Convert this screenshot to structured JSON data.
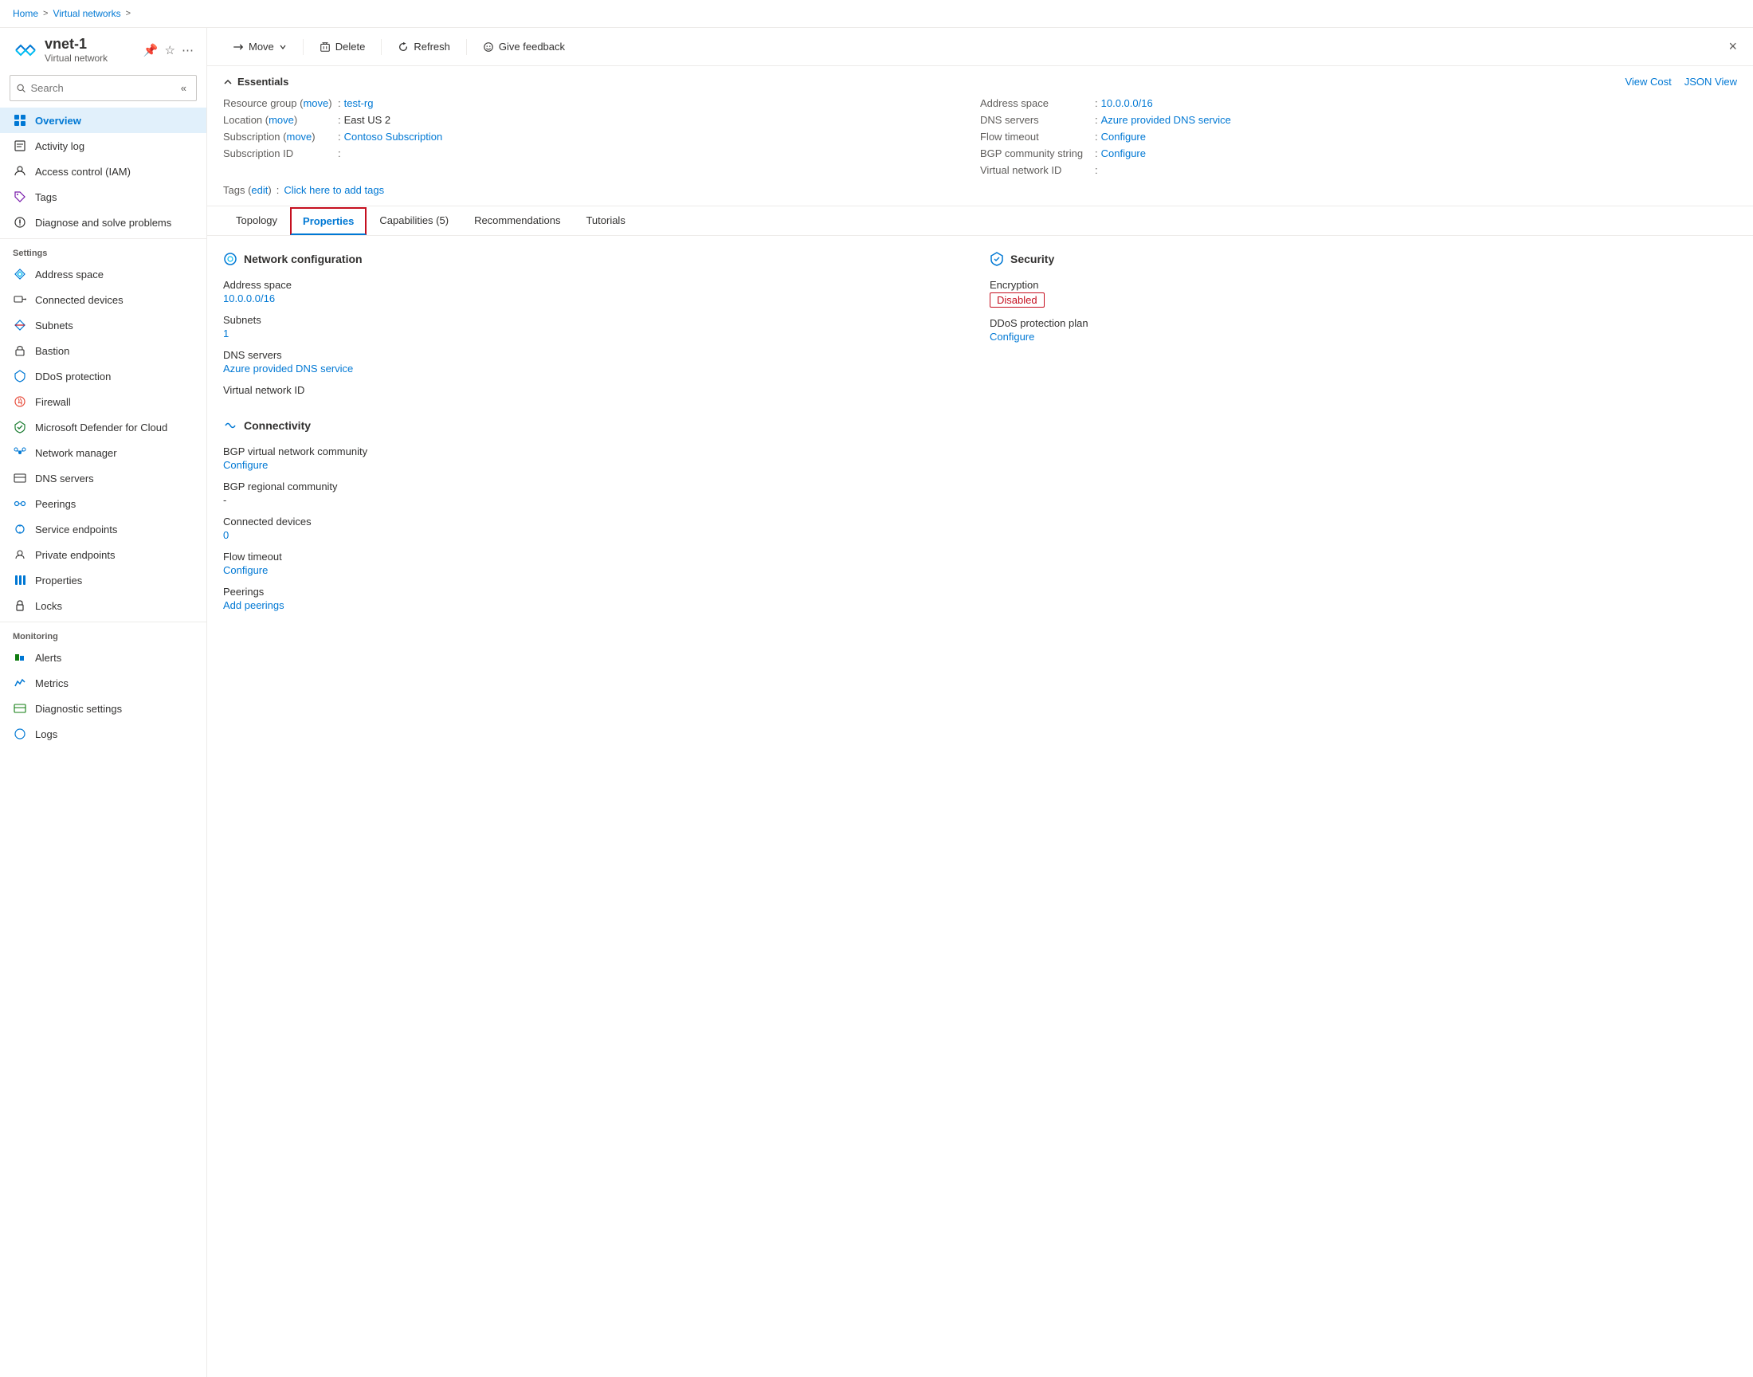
{
  "breadcrumb": {
    "items": [
      "Home",
      "Virtual networks"
    ],
    "separator": ">"
  },
  "resource": {
    "name": "vnet-1",
    "type": "Virtual network",
    "close_label": "×"
  },
  "toolbar": {
    "move_label": "Move",
    "delete_label": "Delete",
    "refresh_label": "Refresh",
    "feedback_label": "Give feedback"
  },
  "search": {
    "placeholder": "Search"
  },
  "sidebar": {
    "nav_items": [
      {
        "id": "overview",
        "label": "Overview",
        "active": true
      },
      {
        "id": "activity-log",
        "label": "Activity log"
      },
      {
        "id": "access-control",
        "label": "Access control (IAM)"
      },
      {
        "id": "tags",
        "label": "Tags"
      },
      {
        "id": "diagnose",
        "label": "Diagnose and solve problems"
      }
    ],
    "settings_label": "Settings",
    "settings_items": [
      {
        "id": "address-space",
        "label": "Address space"
      },
      {
        "id": "connected-devices",
        "label": "Connected devices"
      },
      {
        "id": "subnets",
        "label": "Subnets"
      },
      {
        "id": "bastion",
        "label": "Bastion"
      },
      {
        "id": "ddos-protection",
        "label": "DDoS protection"
      },
      {
        "id": "firewall",
        "label": "Firewall"
      },
      {
        "id": "defender",
        "label": "Microsoft Defender for Cloud"
      },
      {
        "id": "network-manager",
        "label": "Network manager"
      },
      {
        "id": "dns-servers",
        "label": "DNS servers"
      },
      {
        "id": "peerings",
        "label": "Peerings"
      },
      {
        "id": "service-endpoints",
        "label": "Service endpoints"
      },
      {
        "id": "private-endpoints",
        "label": "Private endpoints"
      },
      {
        "id": "properties",
        "label": "Properties"
      },
      {
        "id": "locks",
        "label": "Locks"
      }
    ],
    "monitoring_label": "Monitoring",
    "monitoring_items": [
      {
        "id": "alerts",
        "label": "Alerts"
      },
      {
        "id": "metrics",
        "label": "Metrics"
      },
      {
        "id": "diagnostic-settings",
        "label": "Diagnostic settings"
      },
      {
        "id": "logs",
        "label": "Logs"
      }
    ]
  },
  "essentials": {
    "title": "Essentials",
    "view_cost_label": "View Cost",
    "json_view_label": "JSON View",
    "left_fields": [
      {
        "label": "Resource group",
        "link_label": "move",
        "value": "test-rg",
        "value_is_link": true
      },
      {
        "label": "Location",
        "link_label": "move",
        "value": "East US 2",
        "value_is_link": false
      },
      {
        "label": "Subscription",
        "link_label": "move",
        "value": "Contoso Subscription",
        "value_is_link": true
      },
      {
        "label": "Subscription ID",
        "value": "",
        "value_is_link": false
      }
    ],
    "right_fields": [
      {
        "label": "Address space",
        "value": "10.0.0.0/16",
        "value_is_link": true
      },
      {
        "label": "DNS servers",
        "value": "Azure provided DNS service",
        "value_is_link": true
      },
      {
        "label": "Flow timeout",
        "value": "Configure",
        "value_is_link": true
      },
      {
        "label": "BGP community string",
        "value": "Configure",
        "value_is_link": true
      },
      {
        "label": "Virtual network ID",
        "value": "",
        "value_is_link": false
      }
    ],
    "tags_label": "Tags",
    "tags_edit_label": "edit",
    "tags_value_label": "Click here to add tags"
  },
  "tabs": [
    {
      "id": "topology",
      "label": "Topology"
    },
    {
      "id": "properties",
      "label": "Properties",
      "active": true
    },
    {
      "id": "capabilities",
      "label": "Capabilities (5)"
    },
    {
      "id": "recommendations",
      "label": "Recommendations"
    },
    {
      "id": "tutorials",
      "label": "Tutorials"
    }
  ],
  "properties": {
    "network_config": {
      "title": "Network configuration",
      "fields": [
        {
          "label": "Address space",
          "value": "10.0.0.0/16",
          "value_is_link": true
        },
        {
          "label": "Subnets",
          "value": "1",
          "value_is_link": true
        },
        {
          "label": "DNS servers",
          "value": ""
        },
        {
          "label_link": "Azure provided DNS service",
          "value_is_link": true
        },
        {
          "label": "Virtual network ID",
          "value": ""
        }
      ]
    },
    "security": {
      "title": "Security",
      "encryption_label": "Encryption",
      "encryption_value": "Disabled",
      "ddos_label": "DDoS protection plan",
      "ddos_value": "Configure",
      "ddos_is_link": true
    },
    "connectivity": {
      "title": "Connectivity",
      "fields": [
        {
          "label": "BGP virtual network community",
          "value": ""
        },
        {
          "label_link": "Configure",
          "value_is_link": true
        },
        {
          "label": "BGP regional community",
          "value": "-"
        },
        {
          "label": "Connected devices",
          "value": ""
        },
        {
          "value_link": "0"
        },
        {
          "label": "Flow timeout",
          "value": ""
        },
        {
          "label_link": "Configure",
          "value_is_link": true
        },
        {
          "label": "Peerings",
          "value": ""
        },
        {
          "label_link": "Add peerings",
          "value_is_link": true
        }
      ]
    }
  }
}
